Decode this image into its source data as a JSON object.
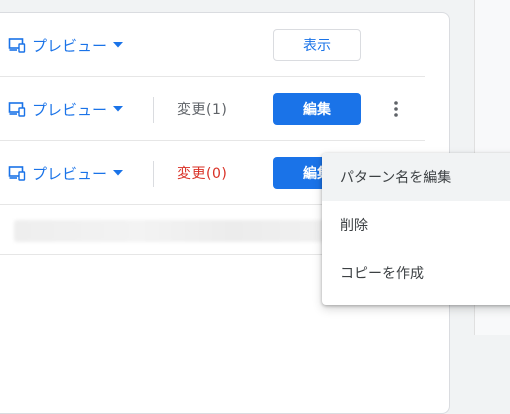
{
  "rows": [
    {
      "preview_label": "プレビュー",
      "action_label": "表示",
      "action_style": "outline"
    },
    {
      "preview_label": "プレビュー",
      "changes_label": "変更(1)",
      "changes_color": "#5f6368",
      "action_label": "編集",
      "action_style": "primary"
    },
    {
      "preview_label": "プレビュー",
      "changes_label": "変更(0)",
      "changes_color": "#d93025",
      "action_label": "編集",
      "action_style": "primary"
    }
  ],
  "menu": {
    "items": [
      {
        "label": "パターン名を編集",
        "hovered": true
      },
      {
        "label": "削除"
      },
      {
        "label": "コピーを作成"
      }
    ]
  },
  "colors": {
    "accent": "#1a73e8",
    "error": "#d93025",
    "muted": "#5f6368"
  },
  "icons": {
    "preview": "devices-icon",
    "dropdown": "arrow-drop-down-icon",
    "more": "more-vert-icon"
  }
}
